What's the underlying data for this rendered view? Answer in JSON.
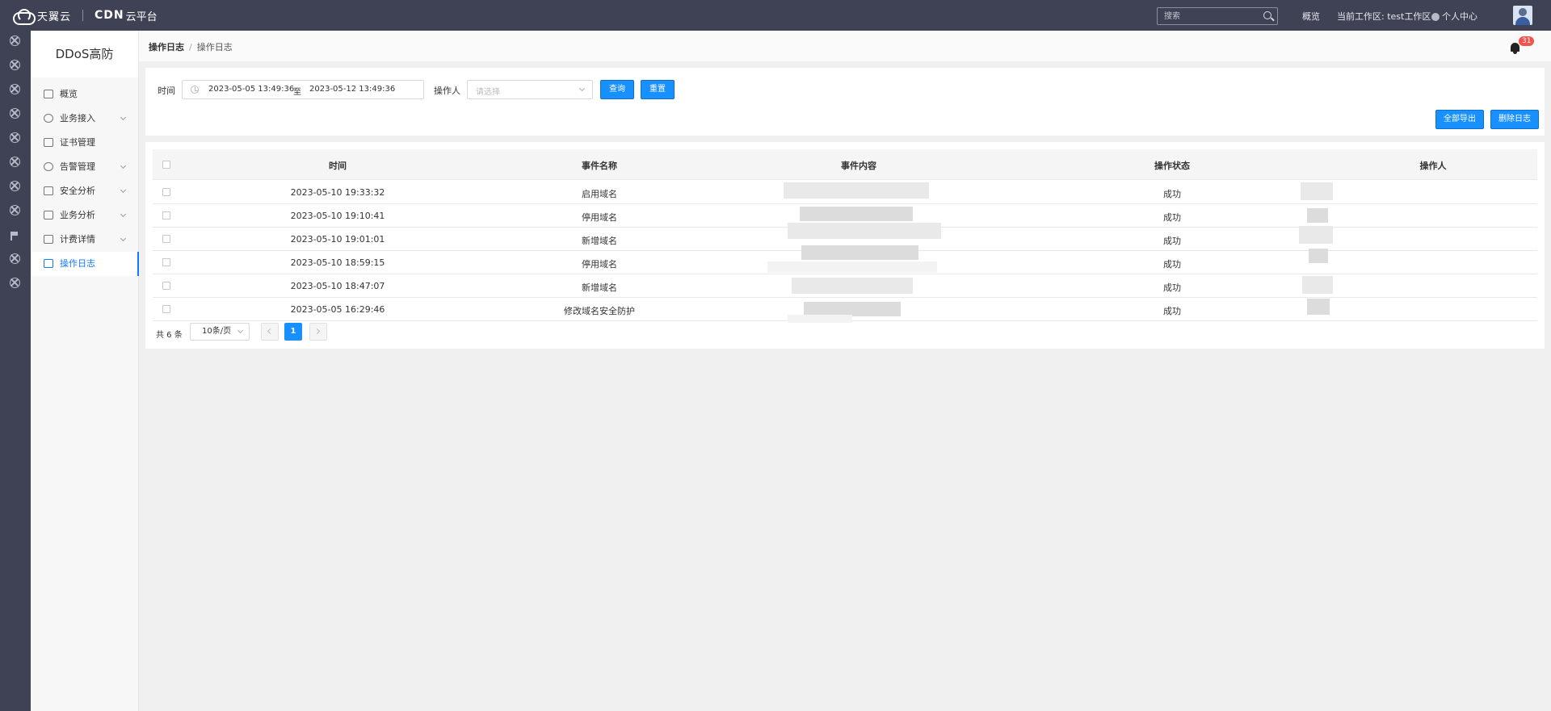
{
  "topbar": {
    "logo_text": "天翼云",
    "product_brand": "CDN",
    "product_suffix": "云平台",
    "search_placeholder": "搜索",
    "overview": "概览",
    "workspace": "当前工作区: test工作区",
    "user_center": "个人中心"
  },
  "sidebar": {
    "title": "DDoS高防",
    "items": [
      {
        "label": "概览",
        "icon": "monitor-icon"
      },
      {
        "label": "业务接入",
        "icon": "globe-icon"
      },
      {
        "label": "证书管理",
        "icon": "certificate-icon"
      },
      {
        "label": "告警管理",
        "icon": "alert-icon"
      },
      {
        "label": "安全分析",
        "icon": "shield-icon"
      },
      {
        "label": "业务分析",
        "icon": "grid-chart-icon"
      },
      {
        "label": "计费详情",
        "icon": "billing-icon"
      },
      {
        "label": "操作日志",
        "icon": "edit-log-icon",
        "active": true
      }
    ]
  },
  "breadcrumb": {
    "parent": "操作日志",
    "current": "操作日志"
  },
  "notifications": {
    "count": "31"
  },
  "filter": {
    "time_label": "时间",
    "start": "2023-05-05 13:49:36",
    "range_separator": "至",
    "end": "2023-05-12 13:49:36",
    "operator_label": "操作人",
    "operator_placeholder": "请选择",
    "query": "查询",
    "reset": "重置",
    "export_all": "全部导出",
    "delete_logs": "删除日志"
  },
  "table": {
    "headers": [
      "时间",
      "事件名称",
      "事件内容",
      "操作状态",
      "操作人"
    ],
    "rows": [
      {
        "time": "2023-05-10 19:33:32",
        "event": "启用域名",
        "status": "成功"
      },
      {
        "time": "2023-05-10 19:10:41",
        "event": "停用域名",
        "status": "成功"
      },
      {
        "time": "2023-05-10 19:01:01",
        "event": "新增域名",
        "status": "成功"
      },
      {
        "time": "2023-05-10 18:59:15",
        "event": "停用域名",
        "status": "成功"
      },
      {
        "time": "2023-05-10 18:47:07",
        "event": "新增域名",
        "status": "成功"
      },
      {
        "time": "2023-05-05 16:29:46",
        "event": "修改域名安全防护",
        "status": "成功"
      }
    ]
  },
  "pagination": {
    "total": "共 6 条",
    "page_size": "10条/页",
    "current": "1"
  },
  "colors": {
    "topbar": "#3f4254",
    "primary": "#1890ff",
    "badge": "#f5524e"
  }
}
